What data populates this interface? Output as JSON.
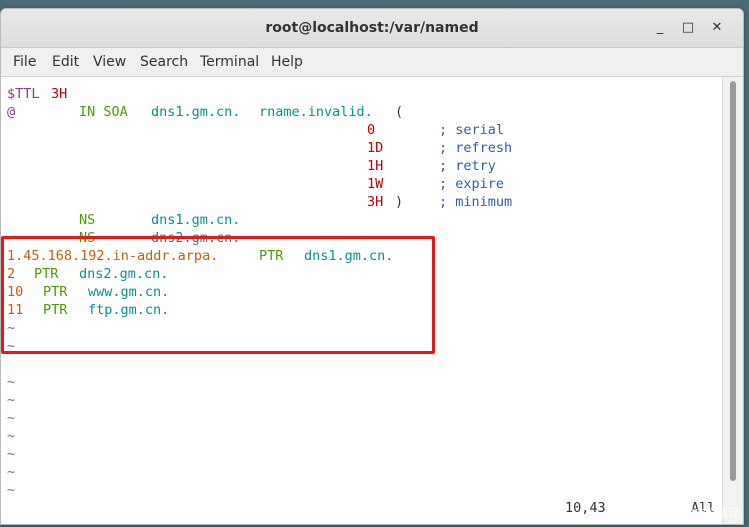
{
  "window": {
    "title": "root@localhost:/var/named",
    "minimize_glyph": "_",
    "maximize_glyph": "□",
    "close_glyph": "✕"
  },
  "menu": [
    "File",
    "Edit",
    "View",
    "Search",
    "Terminal",
    "Help"
  ],
  "editor": {
    "ttl_key": "$TTL",
    "ttl_val": "3H",
    "soa": {
      "at": "@",
      "in_soa": "IN SOA",
      "primary": "dns1.gm.cn.",
      "rname": "rname.invalid.",
      "paren_open": "("
    },
    "soa_fields": [
      {
        "value": "0",
        "comment": "; serial"
      },
      {
        "value": "1D",
        "comment": "; refresh"
      },
      {
        "value": "1H",
        "comment": "; retry"
      },
      {
        "value": "1W",
        "comment": "; expire"
      },
      {
        "value": "3H",
        "close": ")",
        "comment": "; minimum"
      }
    ],
    "ns_records": [
      {
        "type": "NS",
        "target": "dns1.gm.cn."
      },
      {
        "type": "NS",
        "target": "dns2.gm.cn."
      }
    ],
    "ptr_records": [
      {
        "name": "1.45.168.192.in-addr.arpa.",
        "type": "PTR",
        "target": "dns1.gm.cn."
      },
      {
        "name": "2",
        "type": "PTR",
        "target": "dns2.gm.cn."
      },
      {
        "name": "10",
        "type": "PTR",
        "target": "www.gm.cn."
      },
      {
        "name": "11",
        "type": "PTR",
        "target": "ftp.gm.cn."
      }
    ],
    "tilde": "~",
    "status_position": "10,43",
    "status_scroll": "All"
  },
  "watermark": "CSDN @易南学编程",
  "colors": {
    "highlight_box": "#e81818"
  }
}
